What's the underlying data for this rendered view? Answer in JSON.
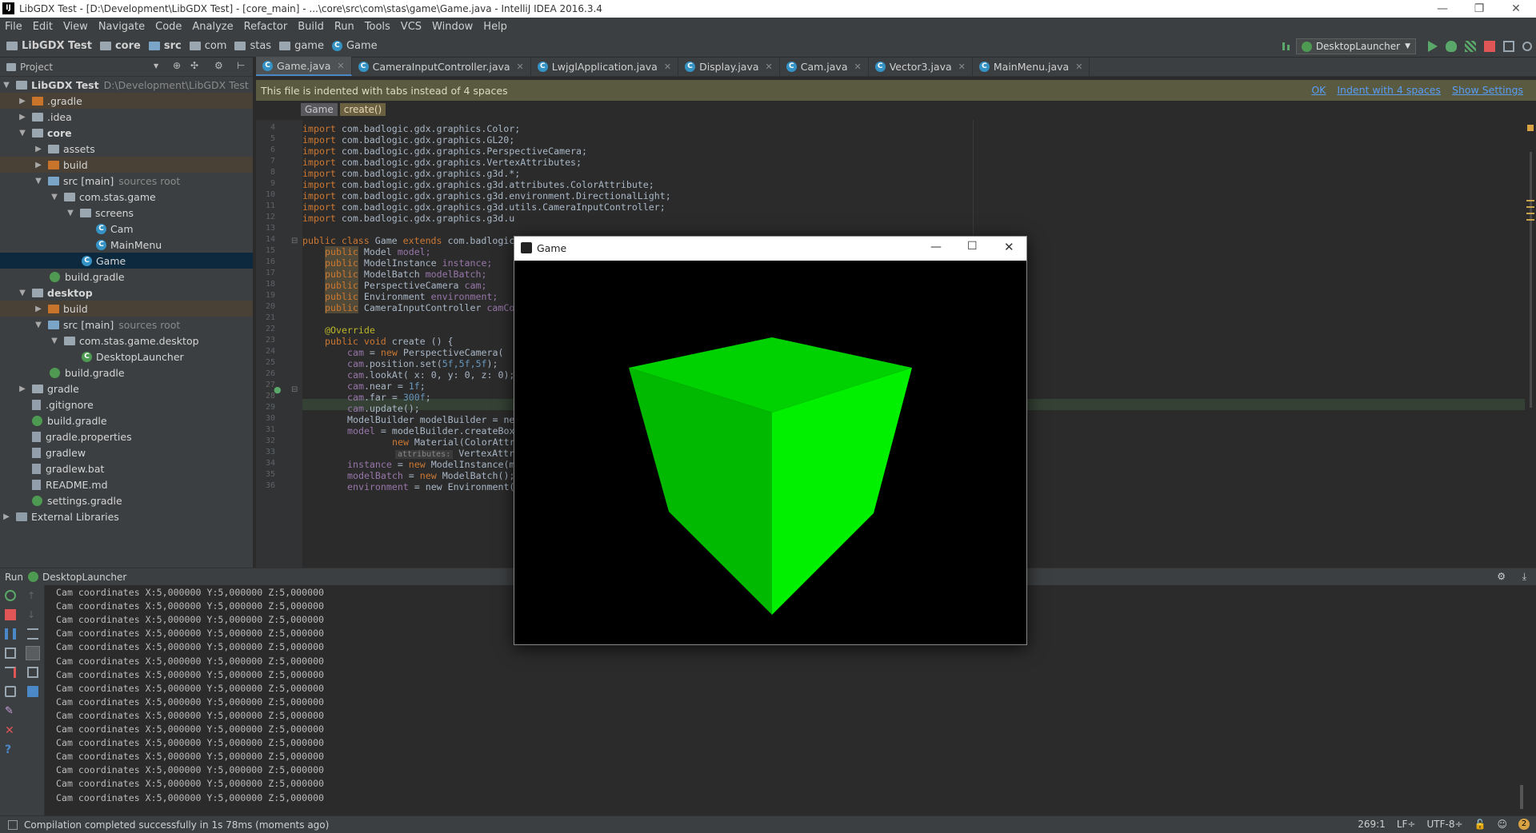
{
  "window": {
    "title": "LibGDX Test - [D:\\Development\\LibGDX Test] - [core_main] - ...\\core\\src\\com\\stas\\game\\Game.java - IntelliJ IDEA 2016.3.4",
    "app_icon": "IJ"
  },
  "menu": [
    "File",
    "Edit",
    "View",
    "Navigate",
    "Code",
    "Analyze",
    "Refactor",
    "Build",
    "Run",
    "Tools",
    "VCS",
    "Window",
    "Help"
  ],
  "breadcrumbs": [
    "LibGDX Test",
    "core",
    "src",
    "com",
    "stas",
    "game",
    "Game"
  ],
  "run_config": "DesktopLauncher",
  "project_panel": {
    "title": "Project",
    "tree": [
      {
        "label": "LibGDX Test",
        "hint": "D:\\Development\\LibGDX Test"
      },
      {
        "label": ".gradle"
      },
      {
        "label": ".idea"
      },
      {
        "label": "core"
      },
      {
        "label": "assets"
      },
      {
        "label": "build"
      },
      {
        "label": "src [main]",
        "hint": "sources root"
      },
      {
        "label": "com.stas.game"
      },
      {
        "label": "screens"
      },
      {
        "label": "Cam"
      },
      {
        "label": "MainMenu"
      },
      {
        "label": "Game"
      },
      {
        "label": "build.gradle"
      },
      {
        "label": "desktop"
      },
      {
        "label": "build"
      },
      {
        "label": "src [main]",
        "hint": "sources root"
      },
      {
        "label": "com.stas.game.desktop"
      },
      {
        "label": "DesktopLauncher"
      },
      {
        "label": "build.gradle"
      },
      {
        "label": "gradle"
      },
      {
        "label": ".gitignore"
      },
      {
        "label": "build.gradle"
      },
      {
        "label": "gradle.properties"
      },
      {
        "label": "gradlew"
      },
      {
        "label": "gradlew.bat"
      },
      {
        "label": "README.md"
      },
      {
        "label": "settings.gradle"
      },
      {
        "label": "External Libraries"
      }
    ]
  },
  "tabs": [
    "Game.java",
    "CameraInputController.java",
    "LwjglApplication.java",
    "Display.java",
    "Cam.java",
    "Vector3.java",
    "MainMenu.java"
  ],
  "notice": {
    "text": "This file is indented with tabs instead of 4 spaces",
    "actions": [
      "OK",
      "Indent with 4 spaces",
      "Show Settings"
    ]
  },
  "editor_breadcrumb": [
    "Game",
    "create()"
  ],
  "line_numbers": [
    "4",
    "5",
    "6",
    "7",
    "8",
    "9",
    "10",
    "11",
    "12",
    "13",
    "14",
    "15",
    "16",
    "17",
    "18",
    "19",
    "20",
    "21",
    "22",
    "23",
    "24",
    "25",
    "26",
    "27",
    "28",
    "29",
    "30",
    "31",
    "32",
    "33",
    "34",
    "35",
    "36"
  ],
  "code": {
    "l4_kw": "import",
    "l4": " com.badlogic.gdx.graphics.Color;",
    "l5_kw": "import",
    "l5": " com.badlogic.gdx.graphics.GL20;",
    "l6_kw": "import",
    "l6": " com.badlogic.gdx.graphics.PerspectiveCamera;",
    "l7_kw": "import",
    "l7": " com.badlogic.gdx.graphics.VertexAttributes;",
    "l8_kw": "import",
    "l8": " com.badlogic.gdx.graphics.g3d.*;",
    "l9_kw": "import",
    "l9": " com.badlogic.gdx.graphics.g3d.attributes.ColorAttribute;",
    "l10_kw": "import",
    "l10": " com.badlogic.gdx.graphics.g3d.environment.DirectionalLight;",
    "l11_kw": "import",
    "l11": " com.badlogic.gdx.graphics.g3d.utils.CameraInputController;",
    "l12_kw": "import",
    "l12": " com.badlogic.gdx.graphics.g3d.u",
    "l14_kw": "public class",
    "l14a": " Game ",
    "l14_kw2": "extends",
    "l14": " com.badlogic",
    "l15_kw": "public",
    "l15a": " Model ",
    "l15": "model;",
    "l16_kw": "public",
    "l16a": " ModelInstance ",
    "l16": "instance;",
    "l17_kw": "public",
    "l17a": " ModelBatch ",
    "l17": "modelBatch;",
    "l18_kw": "public",
    "l18a": " PerspectiveCamera ",
    "l18": "cam;",
    "l19_kw": "public",
    "l19a": " Environment ",
    "l19": "environment;",
    "l20_kw": "public",
    "l20a": " CameraInputController ",
    "l20": "camCo",
    "l22": "@Override",
    "l23_kw": "public void",
    "l23": " create () {",
    "l24a": "cam",
    "l24b": " = ",
    "l24_kw": "new",
    "l24": " PerspectiveCamera(",
    "l25a": "cam",
    "l25": ".position.set(",
    "l25n": "5f,5f,5f",
    "l25e": ");",
    "l26a": "cam",
    "l26": ".lookAt( x: 0, y: 0, z: 0);",
    "l27a": "cam",
    "l27": ".near = ",
    "l27n": "1f",
    "l27e": ";",
    "l28a": "cam",
    "l28": ".far = ",
    "l28n": "300f",
    "l28e": ";",
    "l29a": "cam",
    "l29": ".update();",
    "l30": "ModelBuilder modelBuilder = ne",
    "l31a": "model",
    "l31": " = modelBuilder.createBox",
    "l32_kw": "new",
    "l32": " Material(ColorAttr",
    "l33h": "attributes:",
    "l33": " VertexAttrib",
    "l34a": "instance",
    "l34b": " = ",
    "l34_kw": "new",
    "l34": " ModelInstance(m",
    "l35a": "modelBatch",
    "l35b": " = ",
    "l35_kw": "new",
    "l35": " ModelBatch();",
    "l36a": "environment",
    "l36": " = new Environment()"
  },
  "run_panel": {
    "label": "Run",
    "config": "DesktopLauncher",
    "lines": [
      "Cam coordinates X:5,000000 Y:5,000000 Z:5,000000",
      "Cam coordinates X:5,000000 Y:5,000000 Z:5,000000",
      "Cam coordinates X:5,000000 Y:5,000000 Z:5,000000",
      "Cam coordinates X:5,000000 Y:5,000000 Z:5,000000",
      "Cam coordinates X:5,000000 Y:5,000000 Z:5,000000",
      "Cam coordinates X:5,000000 Y:5,000000 Z:5,000000",
      "Cam coordinates X:5,000000 Y:5,000000 Z:5,000000",
      "Cam coordinates X:5,000000 Y:5,000000 Z:5,000000",
      "Cam coordinates X:5,000000 Y:5,000000 Z:5,000000",
      "Cam coordinates X:5,000000 Y:5,000000 Z:5,000000",
      "Cam coordinates X:5,000000 Y:5,000000 Z:5,000000",
      "Cam coordinates X:5,000000 Y:5,000000 Z:5,000000",
      "Cam coordinates X:5,000000 Y:5,000000 Z:5,000000",
      "Cam coordinates X:5,000000 Y:5,000000 Z:5,000000",
      "Cam coordinates X:5,000000 Y:5,000000 Z:5,000000",
      "Cam coordinates X:5,000000 Y:5,000000 Z:5,000000"
    ]
  },
  "status": {
    "message": "Compilation completed successfully in 1s 78ms (moments ago)",
    "position": "269:1",
    "line_sep": "LF÷",
    "encoding": "UTF-8÷"
  },
  "game_window": {
    "title": "Game",
    "colors": {
      "top": "#00d100",
      "left": "#00b900",
      "right": "#00f000"
    }
  },
  "colors": {
    "keyword": "#cc7832",
    "field": "#9876aa",
    "number": "#6897bb",
    "annotation": "#bbb529",
    "link": "#589df6",
    "selection": "#0d293e"
  }
}
